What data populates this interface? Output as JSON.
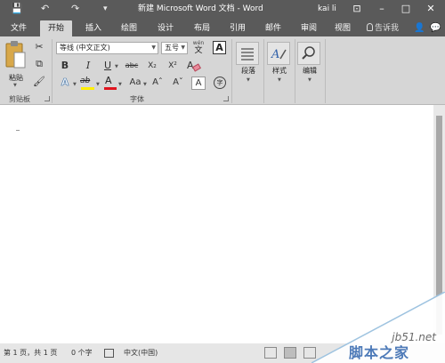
{
  "titlebar": {
    "title": "新建 Microsoft Word 文档 - Word",
    "user": "kai li",
    "save_glyph": "💾",
    "undo_glyph": "↶",
    "redo_glyph": "↷",
    "customize_glyph": "▾",
    "ribbon_display_glyph": "⊡",
    "minimize_glyph": "–",
    "restore_glyph": "□",
    "close_glyph": "✕"
  },
  "tabs": [
    {
      "label": "文件"
    },
    {
      "label": "开始",
      "active": true
    },
    {
      "label": "插入"
    },
    {
      "label": "绘图"
    },
    {
      "label": "设计"
    },
    {
      "label": "布局"
    },
    {
      "label": "引用"
    },
    {
      "label": "邮件"
    },
    {
      "label": "审阅"
    },
    {
      "label": "视图"
    }
  ],
  "tellme": "告诉我",
  "tab_icons": {
    "share": "👤",
    "comment": "💬"
  },
  "ribbon": {
    "clipboard": {
      "label": "剪贴板",
      "paste": "粘贴",
      "cut_glyph": "✂",
      "copy_glyph": "⧉",
      "format_painter_glyph": "🖌"
    },
    "font": {
      "label": "字体",
      "font_name": "等线 (中文正文)",
      "font_size": "五号",
      "wen": "wén",
      "wen_char": "文",
      "char_border": "A",
      "bold": "B",
      "italic": "I",
      "underline": "U",
      "strike": "abc",
      "subscript": "X₂",
      "superscript": "X²",
      "text_effects": "A",
      "highlight": "ab",
      "font_color": "A",
      "change_case": "Aa",
      "grow": "Aˆ",
      "shrink": "Aˇ",
      "clear_format": "A",
      "phonetic": "A",
      "enclose": "字"
    },
    "paragraph": {
      "label": "段落"
    },
    "styles": {
      "label": "样式"
    },
    "editing": {
      "label": "编辑"
    }
  },
  "status": {
    "page": "第 1 页，共 1 页",
    "words": "0 个字",
    "language": "中文(中国)"
  },
  "colors": {
    "titlebar": "#5a5a5a",
    "ribbon": "#d6d6d6",
    "highlight": "#ffef00",
    "font_color": "#e0141e"
  },
  "watermark": {
    "url": "jb51.net",
    "name": "脚本之家"
  }
}
